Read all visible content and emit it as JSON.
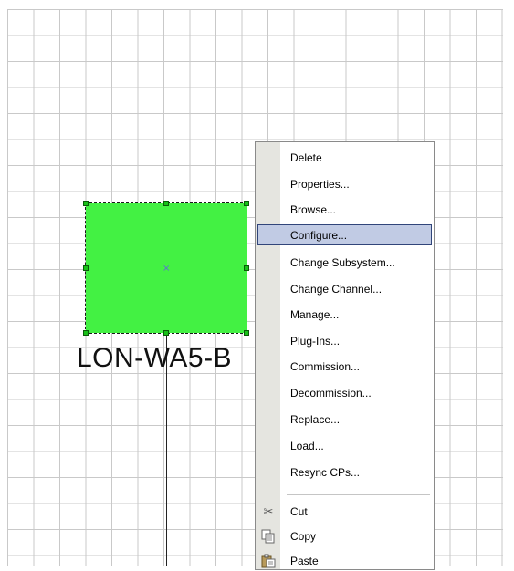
{
  "diagram": {
    "shape_label": "LON-WA5-B",
    "shape_fill_color": "#43f143"
  },
  "context_menu": {
    "items": [
      {
        "label": "Delete"
      },
      {
        "label": "Properties..."
      },
      {
        "label": "Browse..."
      },
      {
        "label": "Configure..."
      },
      {
        "label": "Change Subsystem..."
      },
      {
        "label": "Change Channel..."
      },
      {
        "label": "Manage..."
      },
      {
        "label": "Plug-Ins..."
      },
      {
        "label": "Commission..."
      },
      {
        "label": "Decommission..."
      },
      {
        "label": "Replace..."
      },
      {
        "label": "Load..."
      },
      {
        "label": "Resync CPs..."
      },
      {
        "label": "Cut",
        "icon": "scissors-icon"
      },
      {
        "label": "Copy",
        "icon": "copy-icon"
      },
      {
        "label": "Paste",
        "icon": "paste-icon"
      }
    ],
    "highlighted_item": "Configure...",
    "highlight_color": "#c1cbe4"
  }
}
